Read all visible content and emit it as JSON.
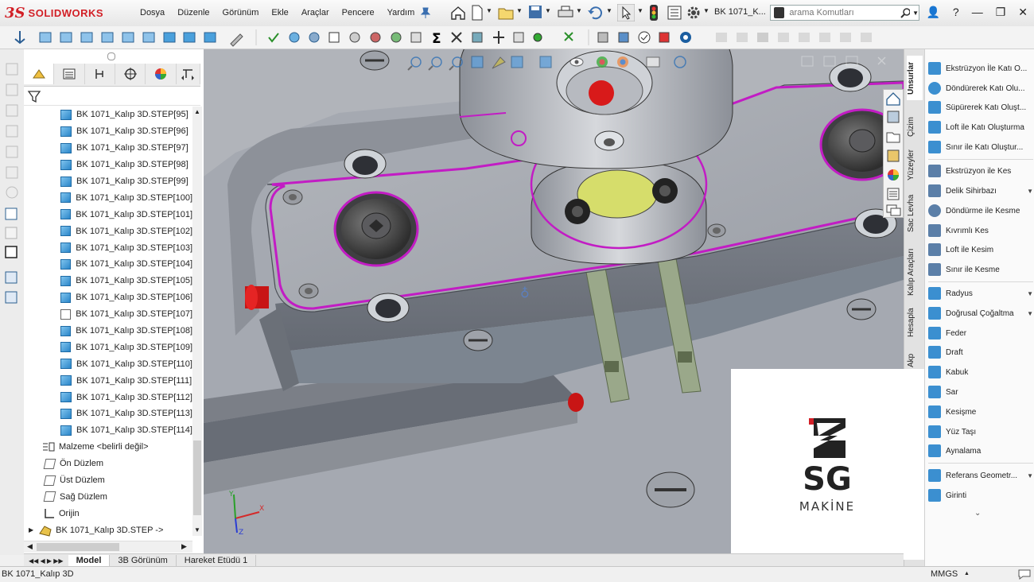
{
  "app": {
    "brand": "SOLIDWORKS",
    "brand_mark": "3S"
  },
  "menu": [
    "Dosya",
    "Düzenle",
    "Görünüm",
    "Ekle",
    "Araçlar",
    "Pencere",
    "Yardım"
  ],
  "document_title": "BK 1071_K...",
  "search": {
    "placeholder": "arama Komutları"
  },
  "window_controls": {
    "user": "👤",
    "help": "?",
    "minimize": "—",
    "restore": "❐",
    "close": "✕"
  },
  "tree": {
    "items": [
      "BK 1071_Kalıp 3D.STEP[95]",
      "BK 1071_Kalıp 3D.STEP[96]",
      "BK 1071_Kalıp 3D.STEP[97]",
      "BK 1071_Kalıp 3D.STEP[98]",
      "BK 1071_Kalıp 3D.STEP[99]",
      "BK 1071_Kalıp 3D.STEP[100]",
      "BK 1071_Kalıp 3D.STEP[101]",
      "BK 1071_Kalıp 3D.STEP[102]",
      "BK 1071_Kalıp 3D.STEP[103]",
      "BK 1071_Kalıp 3D.STEP[104]",
      "BK 1071_Kalıp 3D.STEP[105]",
      "BK 1071_Kalıp 3D.STEP[106]",
      "BK 1071_Kalıp 3D.STEP[107]",
      "BK 1071_Kalıp 3D.STEP[108]",
      "BK 1071_Kalıp 3D.STEP[109]",
      "BK 1071_Kalıp 3D.STEP[110]",
      "BK 1071_Kalıp 3D.STEP[111]",
      "BK 1071_Kalıp 3D.STEP[112]",
      "BK 1071_Kalıp 3D.STEP[113]",
      "BK 1071_Kalıp 3D.STEP[114]"
    ],
    "material": "Malzeme <belirli değil>",
    "planes": [
      "Ön Düzlem",
      "Üst Düzlem",
      "Sağ Düzlem"
    ],
    "origin": "Orijin",
    "root": "BK 1071_Kalıp 3D.STEP ->"
  },
  "task_tabs": [
    "Unsurlar",
    "Çizim",
    "Yüzeyler",
    "Sac Levha",
    "Kalıp Araçları",
    "Hesapla",
    "Akp"
  ],
  "features": [
    {
      "label": "Ekstrüzyon İle Katı O...",
      "color": "#3b8fd0",
      "dropdown": false
    },
    {
      "label": "Döndürerek Katı Olu...",
      "color": "#3b8fd0",
      "dropdown": false
    },
    {
      "label": "Süpürerek Katı Oluşt...",
      "color": "#3b8fd0",
      "dropdown": false
    },
    {
      "label": "Loft ile Katı Oluşturma",
      "color": "#3b8fd0",
      "dropdown": false
    },
    {
      "label": "Sınır ile Katı Oluştur...",
      "color": "#3b8fd0",
      "dropdown": false
    },
    {
      "label": "Ekstrüzyon ile Kes",
      "color": "#5b7fa8",
      "dropdown": false
    },
    {
      "label": "Delik Sihirbazı",
      "color": "#5b7fa8",
      "dropdown": true
    },
    {
      "label": "Döndürme ile Kesme",
      "color": "#5b7fa8",
      "dropdown": false
    },
    {
      "label": "Kıvrımlı Kes",
      "color": "#5b7fa8",
      "dropdown": false
    },
    {
      "label": "Loft ile Kesim",
      "color": "#5b7fa8",
      "dropdown": false
    },
    {
      "label": "Sınır ile Kesme",
      "color": "#5b7fa8",
      "dropdown": false
    },
    {
      "label": "Radyus",
      "color": "#3b8fd0",
      "dropdown": true
    },
    {
      "label": "Doğrusal Çoğaltma",
      "color": "#3b8fd0",
      "dropdown": true
    },
    {
      "label": "Feder",
      "color": "#3b8fd0",
      "dropdown": false
    },
    {
      "label": "Draft",
      "color": "#3b8fd0",
      "dropdown": false
    },
    {
      "label": "Kabuk",
      "color": "#3b8fd0",
      "dropdown": false
    },
    {
      "label": "Sar",
      "color": "#3b8fd0",
      "dropdown": false
    },
    {
      "label": "Kesişme",
      "color": "#3b8fd0",
      "dropdown": false
    },
    {
      "label": "Yüz Taşı",
      "color": "#3b8fd0",
      "dropdown": false
    },
    {
      "label": "Aynalama",
      "color": "#3b8fd0",
      "dropdown": false
    },
    {
      "label": "Referans Geometr...",
      "color": "#3b8fd0",
      "dropdown": true
    },
    {
      "label": "Girinti",
      "color": "#3b8fd0",
      "dropdown": false
    }
  ],
  "overlay_logo": {
    "mark": "SG",
    "subtitle": "MAKİNE"
  },
  "triad": {
    "x": "X",
    "y": "Y",
    "z": "Z"
  },
  "bottom_tabs": [
    "Model",
    "3B Görünüm",
    "Hareket Etüdü 1"
  ],
  "status": {
    "left": "BK 1071_Kalıp 3D",
    "units": "MMGS"
  },
  "colors": {
    "brand": "#d21f26",
    "selection": "#c21cc4",
    "tree_icon": "#2b86c9",
    "model_gray": "#a0a3a8"
  }
}
